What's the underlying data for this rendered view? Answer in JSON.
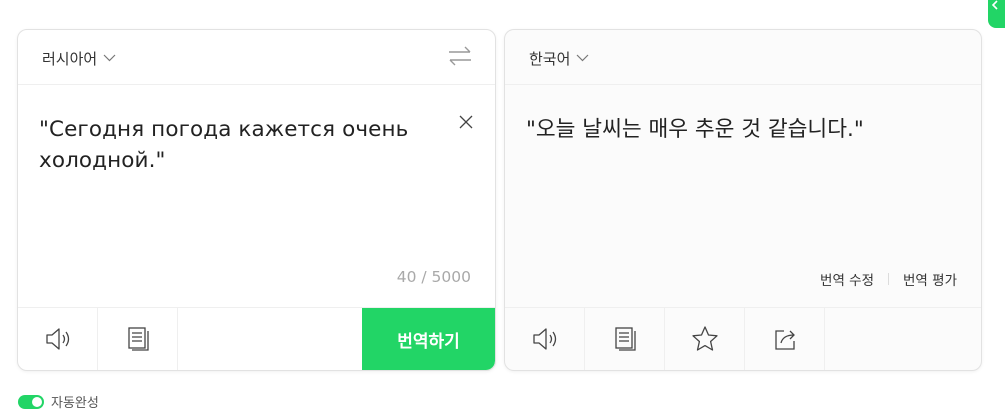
{
  "source": {
    "language": "러시아어",
    "text": "\"Сегодня погода кажется очень холодной.\"",
    "counter": "40 / 5000",
    "translate_button": "번역하기"
  },
  "target": {
    "language": "한국어",
    "text": "\"오늘 날씨는 매우 추운 것 같습니다.\"",
    "edit_link": "번역 수정",
    "rate_link": "번역 평가"
  },
  "footer": {
    "auto_complete_label": "자동완성"
  },
  "colors": {
    "accent": "#22d566",
    "border": "#e2e2e2",
    "muted": "#a9a9a9"
  },
  "icons": {
    "swap": "swap-arrows-icon",
    "clear": "close-icon",
    "speak": "speaker-icon",
    "copy": "copy-icon",
    "favorite": "star-icon",
    "share": "share-icon",
    "dropdown": "chevron-down-icon"
  }
}
